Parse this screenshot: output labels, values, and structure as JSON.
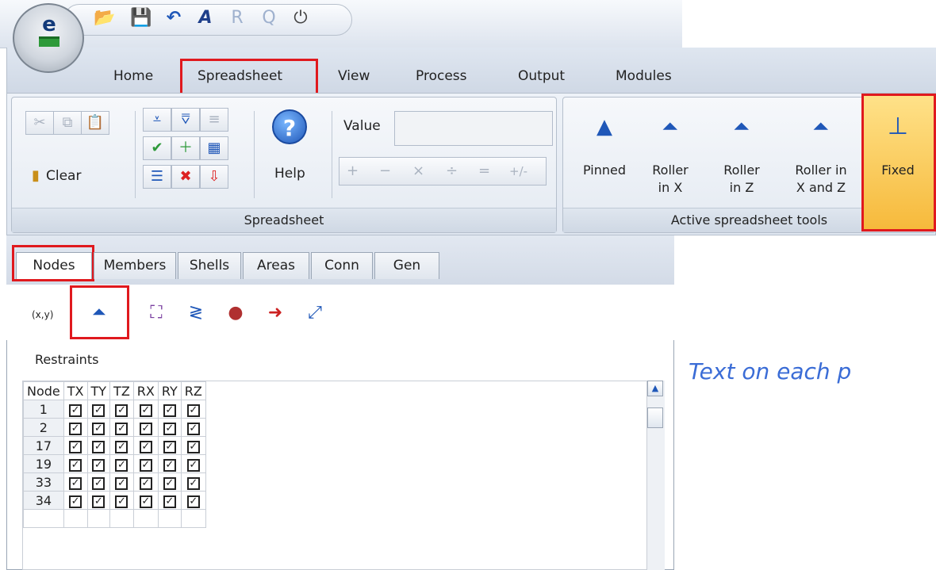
{
  "quick_access": {
    "icons": [
      "folder-open-icon",
      "save-icon",
      "undo-icon",
      "text-tool-icon",
      "report-icon",
      "preview-icon",
      "power-icon"
    ]
  },
  "ribbon": {
    "tabs": [
      "Home",
      "Spreadsheet",
      "View",
      "Process",
      "Output",
      "Modules"
    ],
    "active_tab": "Spreadsheet",
    "spreadsheet_group": {
      "clear_label": "Clear",
      "help_label": "Help",
      "value_label": "Value",
      "value_input": "",
      "calc_buttons": [
        "+",
        "−",
        "×",
        "÷",
        "=",
        "+/-"
      ],
      "group_label": "Spreadsheet"
    },
    "active_tools_group": {
      "tools": [
        {
          "label_1": "Pinned",
          "label_2": ""
        },
        {
          "label_1": "Roller",
          "label_2": "in X"
        },
        {
          "label_1": "Roller",
          "label_2": "in Z"
        },
        {
          "label_1": "Roller in",
          "label_2": "X and Z"
        },
        {
          "label_1": "Fixed",
          "label_2": ""
        }
      ],
      "group_label": "Active spreadsheet tools"
    }
  },
  "panel": {
    "tabs": [
      "Nodes",
      "Members",
      "Shells",
      "Areas",
      "Conn",
      "Gen"
    ],
    "active_tab": "Nodes",
    "coord_label": "(x,y)",
    "section_label": "Restraints",
    "grid": {
      "headers": [
        "Node",
        "TX",
        "TY",
        "TZ",
        "RX",
        "RY",
        "RZ"
      ],
      "rows": [
        {
          "node": "1",
          "checks": [
            true,
            true,
            true,
            true,
            true,
            true
          ]
        },
        {
          "node": "2",
          "checks": [
            true,
            true,
            true,
            true,
            true,
            true
          ]
        },
        {
          "node": "17",
          "checks": [
            true,
            true,
            true,
            true,
            true,
            true
          ]
        },
        {
          "node": "19",
          "checks": [
            true,
            true,
            true,
            true,
            true,
            true
          ]
        },
        {
          "node": "33",
          "checks": [
            true,
            true,
            true,
            true,
            true,
            true
          ]
        },
        {
          "node": "34",
          "checks": [
            true,
            true,
            true,
            true,
            true,
            true
          ]
        }
      ]
    }
  },
  "annotation": {
    "text": "Text on each p",
    "color": "#3a6cd6"
  },
  "colors": {
    "highlight": "#e0191e",
    "fixed_bg": "#f8c44a"
  }
}
